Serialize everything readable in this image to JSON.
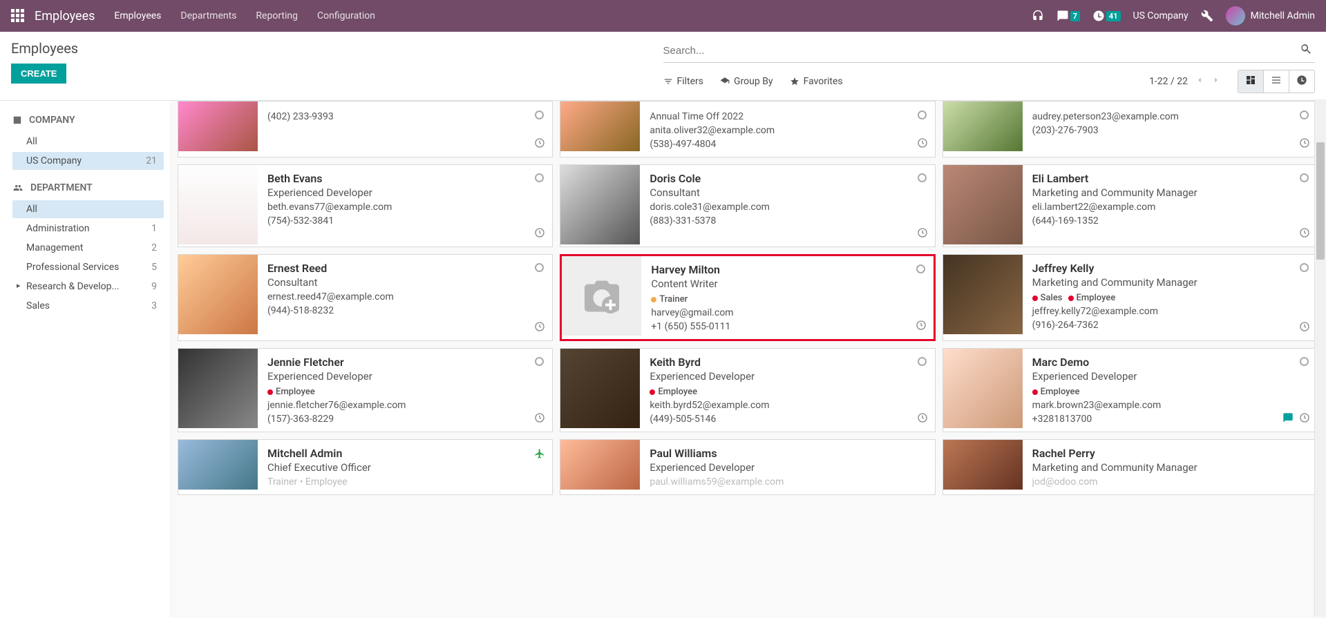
{
  "navbar": {
    "brand": "Employees",
    "links": [
      "Employees",
      "Departments",
      "Reporting",
      "Configuration"
    ],
    "msg_badge": "7",
    "activity_badge": "41",
    "company": "US Company",
    "user": "Mitchell Admin"
  },
  "control": {
    "breadcrumb": "Employees",
    "create": "CREATE",
    "search_placeholder": "Search...",
    "filters": "Filters",
    "groupby": "Group By",
    "favorites": "Favorites",
    "pager": "1-22 / 22"
  },
  "sidebar": {
    "company_heading": "COMPANY",
    "company_items": [
      {
        "label": "All",
        "selected": false,
        "count": ""
      },
      {
        "label": "US Company",
        "selected": true,
        "count": "21"
      }
    ],
    "dept_heading": "DEPARTMENT",
    "dept_items": [
      {
        "label": "All",
        "selected": true,
        "count": ""
      },
      {
        "label": "Administration",
        "selected": false,
        "count": "1"
      },
      {
        "label": "Management",
        "selected": false,
        "count": "2"
      },
      {
        "label": "Professional Services",
        "selected": false,
        "count": "5"
      },
      {
        "label": "Research & Develop...",
        "selected": false,
        "count": "9",
        "caret": true
      },
      {
        "label": "Sales",
        "selected": false,
        "count": "3"
      }
    ]
  },
  "cards_row_partial_top": [
    {
      "name": "",
      "job": "",
      "email": "",
      "phone": "(402) 233-9393",
      "av": "av1"
    },
    {
      "name": "",
      "job": "",
      "extra": "Annual Time Off 2022",
      "email": "anita.oliver32@example.com",
      "phone": "(538)-497-4804",
      "av": "av2"
    },
    {
      "name": "",
      "job": "",
      "email": "audrey.peterson23@example.com",
      "phone": "(203)-276-7903",
      "av": "av3"
    }
  ],
  "cards_rows": [
    [
      {
        "name": "Beth Evans",
        "job": "Experienced Developer",
        "email": "beth.evans77@example.com",
        "phone": "(754)-532-3841",
        "av": "av4"
      },
      {
        "name": "Doris Cole",
        "job": "Consultant",
        "email": "doris.cole31@example.com",
        "phone": "(883)-331-5378",
        "av": "av5"
      },
      {
        "name": "Eli Lambert",
        "job": "Marketing and Community Manager",
        "email": "eli.lambert22@example.com",
        "phone": "(644)-169-1352",
        "av": "av6"
      }
    ],
    [
      {
        "name": "Ernest Reed",
        "job": "Consultant",
        "email": "ernest.reed47@example.com",
        "phone": "(944)-518-8232",
        "av": "av7"
      },
      {
        "name": "Harvey Milton",
        "job": "Content Writer",
        "tags": [
          {
            "label": "Trainer",
            "color": "#f0ad4e"
          }
        ],
        "email": "harvey@gmail.com",
        "phone": "+1 (650) 555-0111",
        "placeholder": true,
        "highlighted": true
      },
      {
        "name": "Jeffrey Kelly",
        "job": "Marketing and Community Manager",
        "tags": [
          {
            "label": "Sales",
            "color": "#e4002b"
          },
          {
            "label": "Employee",
            "color": "#e4002b"
          }
        ],
        "email": "jeffrey.kelly72@example.com",
        "phone": "(916)-264-7362",
        "av": "av8"
      }
    ],
    [
      {
        "name": "Jennie Fletcher",
        "job": "Experienced Developer",
        "tags": [
          {
            "label": "Employee",
            "color": "#e4002b"
          }
        ],
        "email": "jennie.fletcher76@example.com",
        "phone": "(157)-363-8229",
        "av": "av9"
      },
      {
        "name": "Keith Byrd",
        "job": "Experienced Developer",
        "tags": [
          {
            "label": "Employee",
            "color": "#e4002b"
          }
        ],
        "email": "keith.byrd52@example.com",
        "phone": "(449)-505-5146",
        "av": "av10"
      },
      {
        "name": "Marc Demo",
        "job": "Experienced Developer",
        "tags": [
          {
            "label": "Employee",
            "color": "#e4002b"
          }
        ],
        "email": "mark.brown23@example.com",
        "phone": "+3281813700",
        "av": "av11",
        "has_chat": true
      }
    ]
  ],
  "cards_row_partial_bot": [
    {
      "name": "Mitchell Admin",
      "job": "Chief Executive Officer",
      "tags_preview": "Trainer  •  Employee",
      "av": "av12",
      "plane": true
    },
    {
      "name": "Paul Williams",
      "job": "Experienced Developer",
      "email_preview": "paul.williams59@example.com",
      "av": "av13"
    },
    {
      "name": "Rachel Perry",
      "job": "Marketing and Community Manager",
      "email_preview": "jod@odoo.com",
      "av": "av14"
    }
  ],
  "colors": {
    "accent": "#00a09d",
    "navbar": "#714b67",
    "highlight_border": "#e4002b"
  }
}
